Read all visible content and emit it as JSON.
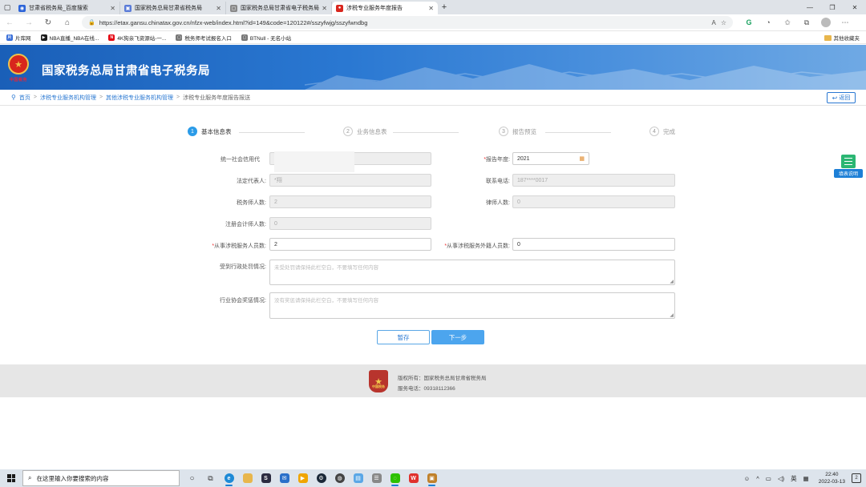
{
  "browser": {
    "tabs": [
      {
        "label": "甘肃省税务局_百度搜索",
        "color": "#2d64d8",
        "glyph": "◉"
      },
      {
        "label": "国家税务总局甘肃省税务局",
        "color": "#5a7bd8",
        "glyph": "▣"
      },
      {
        "label": "国家税务总局甘肃省电子税务局",
        "color": "#888888",
        "glyph": "▢"
      },
      {
        "label": "涉税专业服务年度报告",
        "color": "#d8261d",
        "glyph": "●"
      }
    ],
    "url": "https://etax.gansu.chinatax.gov.cn/nfzx-web/index.html?id=149&code=120122#/sszyfwjg/sszyfwndbg",
    "bookmarks": [
      {
        "label": "片库网",
        "color": "#3a6fd8",
        "glyph": "片"
      },
      {
        "label": "NBA直播_NBA在线...",
        "color": "#1a1a1a",
        "glyph": "▶"
      },
      {
        "label": "4K狗亲飞资源站-一...",
        "color": "#e50914",
        "glyph": "N"
      },
      {
        "label": "税务师考试报名入口",
        "color": "#777777",
        "glyph": "▢"
      },
      {
        "label": "BTNull - 无名小站",
        "color": "#777777",
        "glyph": "▢"
      }
    ],
    "favorites_label": "其他收藏夹"
  },
  "site": {
    "title": "国家税务总局甘肃省电子税务局",
    "emblem_text": "中国税务"
  },
  "breadcrumb": {
    "items": [
      "首页",
      "涉税专业服务机构管理",
      "其他涉税专业服务机构管理",
      "涉税专业服务年度报告报送"
    ],
    "back_label": "返回"
  },
  "steps": [
    {
      "num": "1",
      "label": "基本信息表"
    },
    {
      "num": "2",
      "label": "业务信息表"
    },
    {
      "num": "3",
      "label": "报告预览"
    },
    {
      "num": "4",
      "label": "完成"
    }
  ],
  "form": {
    "credit_code_label": "统一社会信用代",
    "report_year_label": "报告年度:",
    "report_year_value": "2021",
    "legal_rep_label": "法定代表人:",
    "legal_rep_value": "*翔",
    "phone_label": "联系电话:",
    "phone_value": "187****0017",
    "tax_agents_label": "税务师人数:",
    "tax_agents_value": "2",
    "lawyers_label": "律师人数:",
    "lawyers_value": "0",
    "cpa_label": "注册会计师人数:",
    "cpa_value": "0",
    "staff_label": "从事涉税服务人员数:",
    "staff_value": "2",
    "foreign_staff_label": "从事涉税服务外籍人员数:",
    "foreign_staff_value": "0",
    "penalty_label": "受到行政处罚情况:",
    "penalty_placeholder": "未受处罚请保持此栏空白，不要填写任何内容",
    "award_label": "行业协会奖惩情况:",
    "award_placeholder": "没有奖惩请保持此栏空白，不要填写任何内容",
    "save_label": "暂存",
    "next_label": "下一步"
  },
  "help": {
    "label": "填表说明"
  },
  "footer": {
    "copyright": "版权所有：国家税务总局甘肃省税务局",
    "phone": "服务电话：09318112366",
    "logo_text": "中国税务"
  },
  "taskbar": {
    "search_placeholder": "在这里输入你要搜索的内容",
    "ime": "英",
    "time": "22:40",
    "date": "2022-03-13",
    "notif_count": "2"
  }
}
